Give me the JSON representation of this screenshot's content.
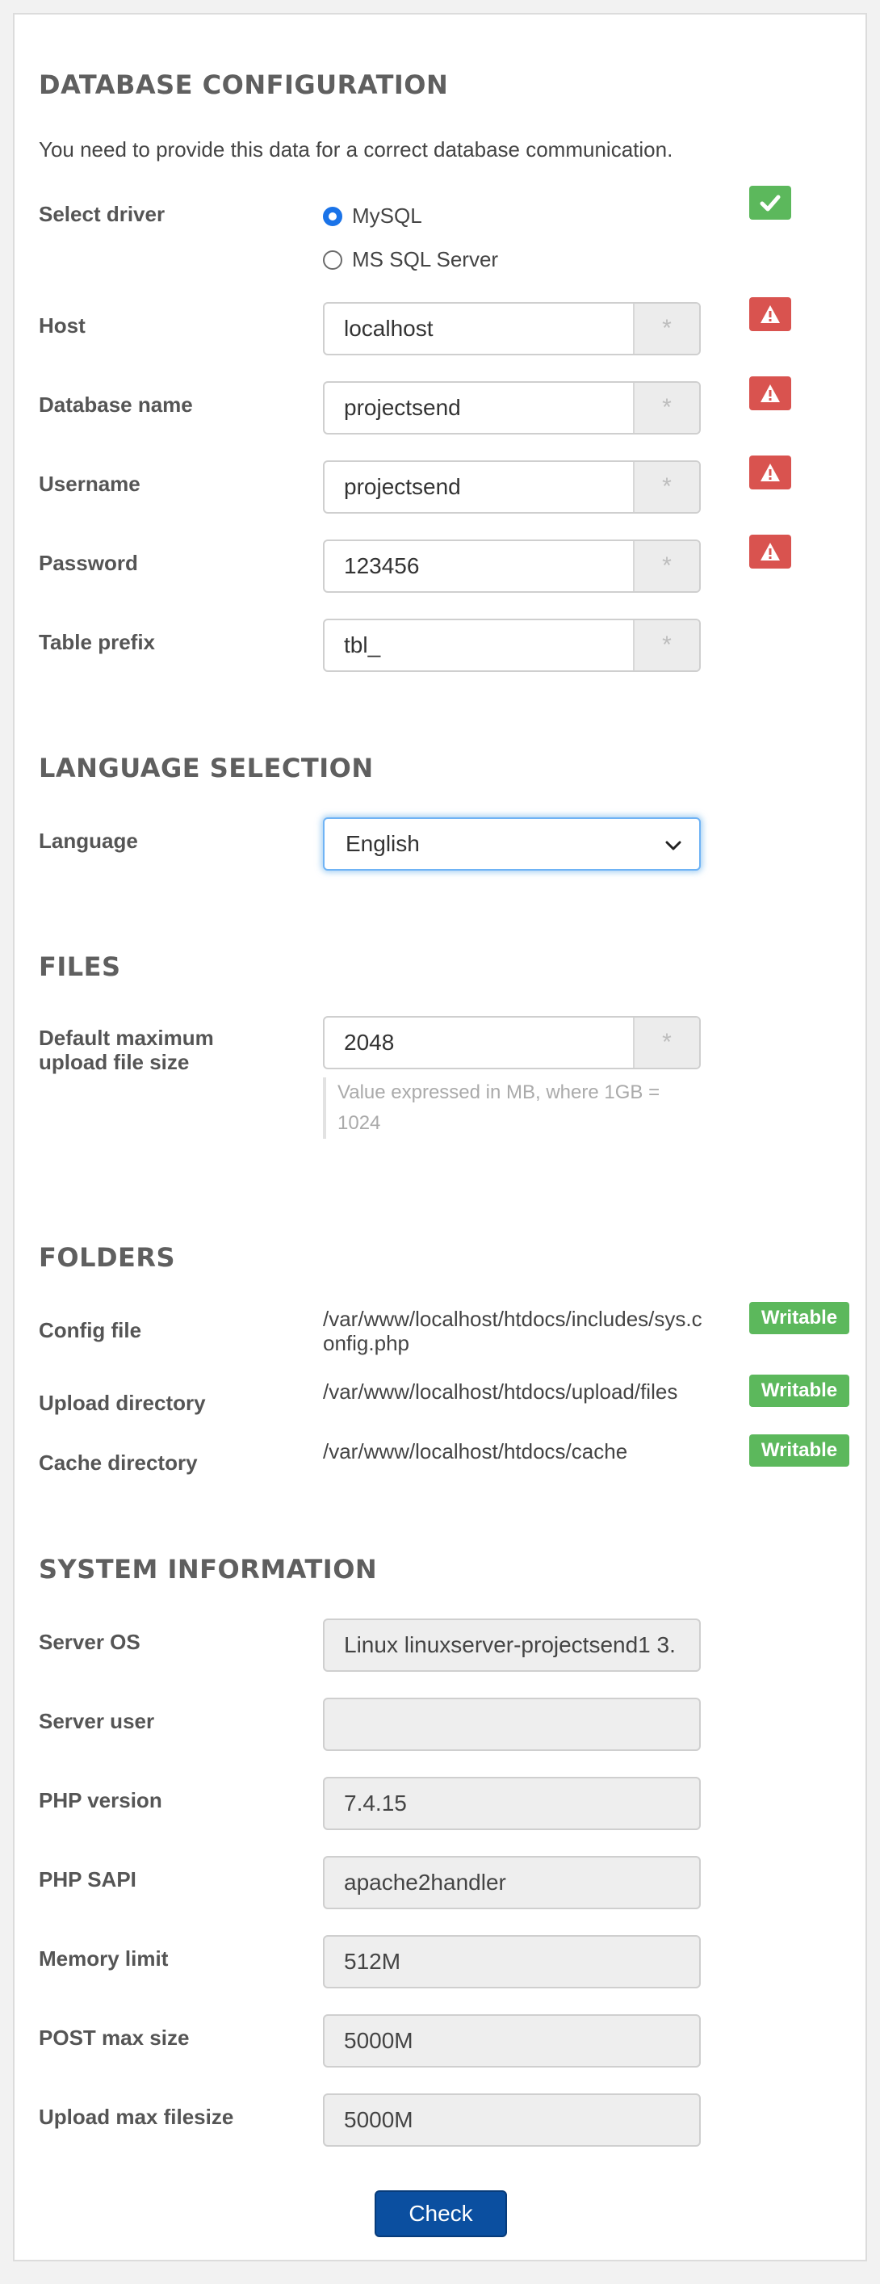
{
  "database": {
    "heading": "DATABASE CONFIGURATION",
    "intro": "You need to provide this data for a correct database communication.",
    "driver": {
      "label": "Select driver",
      "options": [
        "MySQL",
        "MS SQL Server"
      ],
      "selected": "MySQL"
    },
    "fields": {
      "host": {
        "label": "Host",
        "value": "localhost",
        "status": "error"
      },
      "dbname": {
        "label": "Database name",
        "value": "projectsend",
        "status": "error"
      },
      "username": {
        "label": "Username",
        "value": "projectsend",
        "status": "error"
      },
      "password": {
        "label": "Password",
        "value": "123456",
        "status": "error"
      },
      "prefix": {
        "label": "Table prefix",
        "value": "tbl_"
      }
    },
    "required_marker": "*",
    "driver_status": "ok"
  },
  "language": {
    "heading": "LANGUAGE SELECTION",
    "label": "Language",
    "selected": "English"
  },
  "files": {
    "heading": "FILES",
    "label": "Default maximum upload file size",
    "value": "2048",
    "help": "Value expressed in MB, where 1GB = 1024"
  },
  "folders": {
    "heading": "FOLDERS",
    "items": [
      {
        "label": "Config file",
        "path": "/var/www/localhost/htdocs/includes/sys.config.php",
        "status": "Writable"
      },
      {
        "label": "Upload directory",
        "path": "/var/www/localhost/htdocs/upload/files",
        "status": "Writable"
      },
      {
        "label": "Cache directory",
        "path": "/var/www/localhost/htdocs/cache",
        "status": "Writable"
      }
    ]
  },
  "system": {
    "heading": "SYSTEM INFORMATION",
    "items": [
      {
        "label": "Server OS",
        "value": "Linux linuxserver-projectsend1 3."
      },
      {
        "label": "Server user",
        "value": ""
      },
      {
        "label": "PHP version",
        "value": "7.4.15"
      },
      {
        "label": "PHP SAPI",
        "value": "apache2handler"
      },
      {
        "label": "Memory limit",
        "value": "512M"
      },
      {
        "label": "POST max size",
        "value": "5000M"
      },
      {
        "label": "Upload max filesize",
        "value": "5000M"
      }
    ]
  },
  "actions": {
    "check_label": "Check"
  },
  "colors": {
    "ok": "#5cb85c",
    "error": "#d9534f",
    "primary": "#0b4fa0"
  },
  "icons": {
    "ok": "check-icon",
    "error": "warning-icon",
    "required": "asterisk-icon",
    "dropdown": "chevron-down-icon"
  }
}
